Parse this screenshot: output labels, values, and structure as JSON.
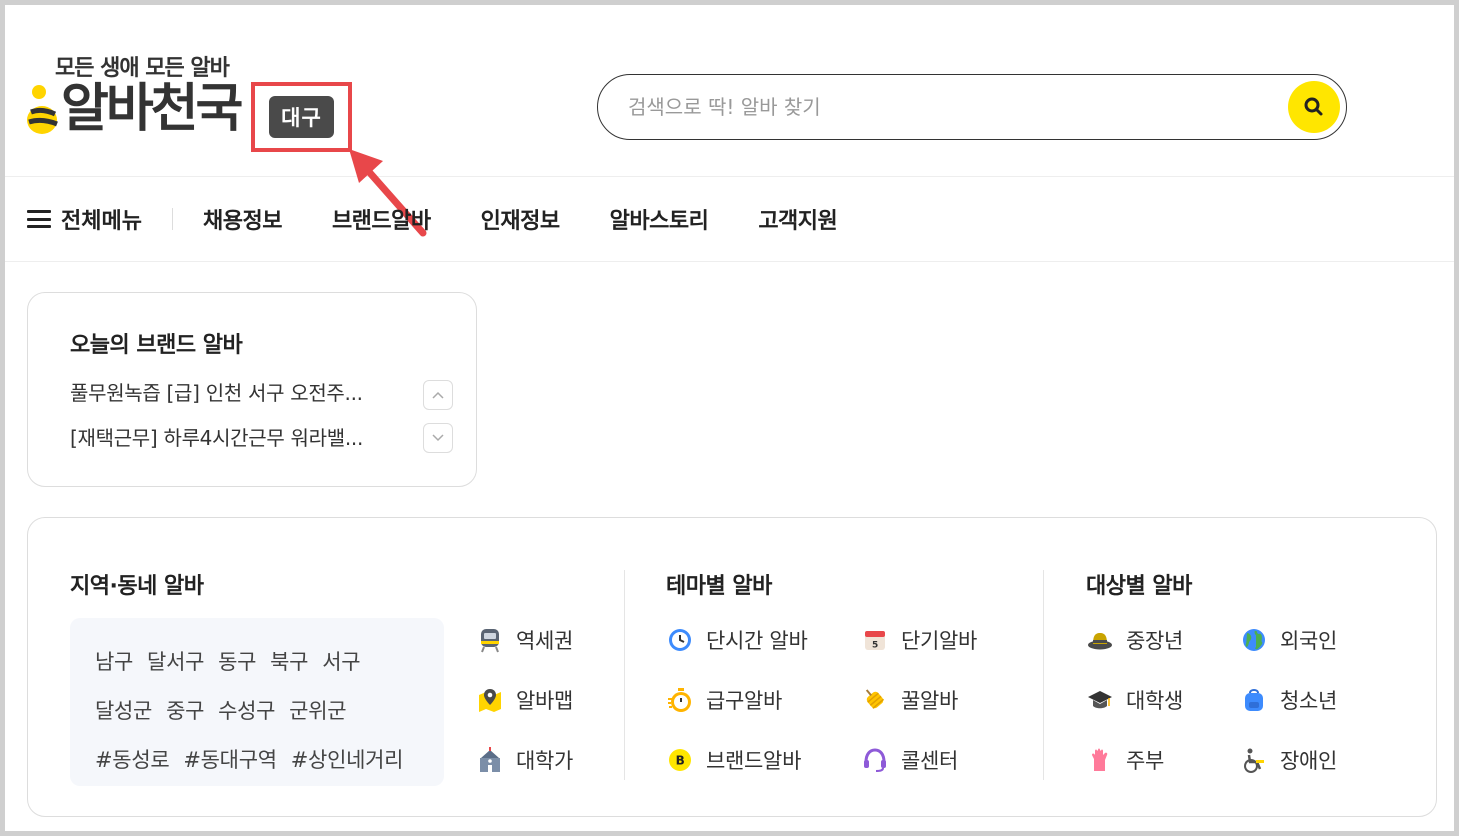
{
  "header": {
    "tagline": "모든 생애 모든 알바",
    "logo_text": "알바천국",
    "region_badge": "대구",
    "search_placeholder": "검색으로 딱! 알바 찾기"
  },
  "nav": {
    "menu_label": "전체메뉴",
    "items": [
      {
        "label": "채용정보"
      },
      {
        "label": "브랜드알바"
      },
      {
        "label": "인재정보"
      },
      {
        "label": "알바스토리"
      },
      {
        "label": "고객지원"
      }
    ]
  },
  "brand_card": {
    "title": "오늘의 브랜드 알바",
    "items": [
      "풀무원녹즙 [급] 인천 서구 오전주...",
      "[재택근무] 하루4시간근무 워라밸..."
    ]
  },
  "region_col": {
    "title": "지역·동네 알바",
    "rows": [
      [
        "남구",
        "달서구",
        "동구",
        "북구",
        "서구"
      ],
      [
        "달성군",
        "중구",
        "수성구",
        "군위군"
      ],
      [
        "#동성로",
        "#동대구역",
        "#상인네거리"
      ]
    ],
    "side_items": [
      {
        "label": "역세권",
        "icon": "subway-icon"
      },
      {
        "label": "알바맵",
        "icon": "map-pin-icon"
      },
      {
        "label": "대학가",
        "icon": "school-icon"
      }
    ]
  },
  "theme_col": {
    "title": "테마별 알바",
    "items": [
      {
        "label": "단시간 알바",
        "icon": "clock-icon"
      },
      {
        "label": "단기알바",
        "icon": "calendar-icon"
      },
      {
        "label": "급구알바",
        "icon": "stopwatch-icon"
      },
      {
        "label": "꿀알바",
        "icon": "honey-icon"
      },
      {
        "label": "브랜드알바",
        "icon": "brand-b-icon"
      },
      {
        "label": "콜센터",
        "icon": "headset-icon"
      }
    ]
  },
  "target_col": {
    "title": "대상별 알바",
    "items": [
      {
        "label": "중장년",
        "icon": "hat-icon"
      },
      {
        "label": "외국인",
        "icon": "globe-icon"
      },
      {
        "label": "대학생",
        "icon": "graduation-cap-icon"
      },
      {
        "label": "청소년",
        "icon": "backpack-icon"
      },
      {
        "label": "주부",
        "icon": "rubber-glove-icon"
      },
      {
        "label": "장애인",
        "icon": "wheelchair-icon"
      }
    ]
  },
  "colors": {
    "accent_yellow": "#ffe600",
    "highlight_red": "#e8474a",
    "badge_dark": "#4a4a4a"
  }
}
